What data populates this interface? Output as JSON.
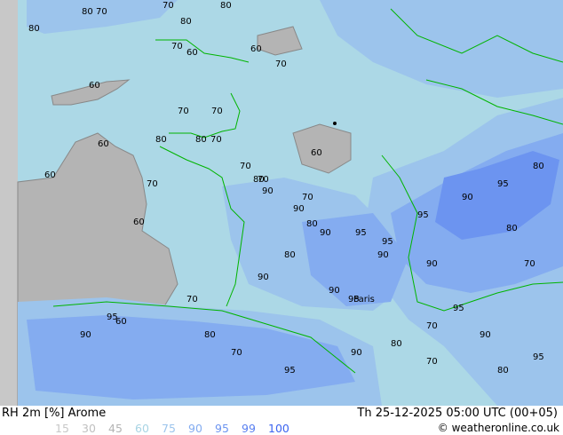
{
  "title": "RH 2m [%] Arome",
  "datetime": "Th 25-12-2025 05:00 UTC (00+05)",
  "copyright": "© weatheronline.co.uk",
  "legend": [
    {
      "value": "15",
      "color": "#c8c8c8"
    },
    {
      "value": "30",
      "color": "#c0c0c0"
    },
    {
      "value": "45",
      "color": "#b4b4b4"
    },
    {
      "value": "60",
      "color": "#a8d4e4"
    },
    {
      "value": "75",
      "color": "#9cc4ec"
    },
    {
      "value": "90",
      "color": "#84acf0"
    },
    {
      "value": "95",
      "color": "#6c94f0"
    },
    {
      "value": "99",
      "color": "#5a80f0"
    },
    {
      "value": "100",
      "color": "#3c64f0"
    }
  ],
  "colors": {
    "sea": "#acd8e6",
    "dry": "#b4b4b4",
    "border": "#00b400",
    "contour": "#808080"
  },
  "contour_labels": [
    "80",
    "70",
    "80",
    "70",
    "80",
    "80",
    "60",
    "70",
    "60",
    "60",
    "70",
    "70",
    "70",
    "80",
    "70",
    "60",
    "80",
    "70",
    "70",
    "60",
    "60",
    "70",
    "60",
    "80",
    "90",
    "70",
    "90",
    "80",
    "90",
    "95",
    "90",
    "95",
    "95",
    "90",
    "80",
    "90",
    "95",
    "90",
    "95",
    "90",
    "70",
    "80",
    "70",
    "60",
    "80",
    "70",
    "95",
    "90",
    "80",
    "95",
    "70",
    "80",
    "90",
    "95",
    "80",
    "70",
    "90",
    "95"
  ],
  "city_label": "Paris"
}
